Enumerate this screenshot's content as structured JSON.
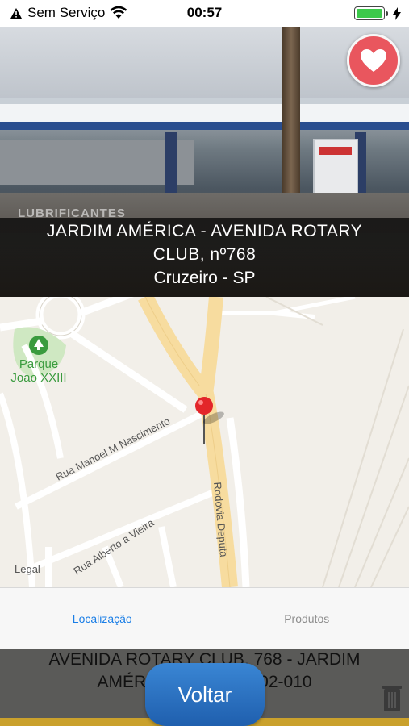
{
  "status_bar": {
    "carrier": "Sem Serviço",
    "time": "00:57",
    "battery_level": 1.0
  },
  "hero": {
    "photo_label": "LUBRIFICANTES",
    "address_line1": "JARDIM AMÉRICA - AVENIDA ROTARY",
    "address_line2": "CLUB, nº768",
    "city": "Cruzeiro - SP",
    "favorite_icon": "heart-icon"
  },
  "map": {
    "park_name_line1": "Parque",
    "park_name_line2": "Joao XXIII",
    "street1": "Rua Manoel M Nascimento",
    "street2": "Rodovia Deputa",
    "street3": "Rua Alberto a Vieira",
    "legal": "Legal"
  },
  "tabs": [
    {
      "label": "Localização",
      "active": true
    },
    {
      "label": "Produtos",
      "active": false
    }
  ],
  "bottom": {
    "address_line1": "AVENIDA ROTARY CLUB, 768 - JARDIM",
    "address_line2": "AMÉR                        02-010",
    "back_button": "Voltar"
  },
  "colors": {
    "accent": "#1a7ee6",
    "favorite": "#e9565e",
    "button": "#2a72c4"
  }
}
